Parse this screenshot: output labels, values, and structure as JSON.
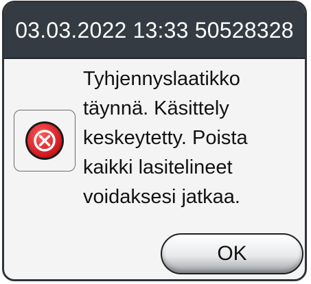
{
  "dialog": {
    "header": {
      "datetime": "03.03.2022 13:33",
      "serial": "50528328"
    },
    "icon": "error-icon",
    "message": "Tyhjennyslaatikko\ntäynnä. Käsittely\nkeskeytetty. Poista\nkaikki lasitelineet\nvoidaksesi jatkaa.",
    "ok_label": "OK"
  },
  "colors": {
    "titlebar": "#353b42",
    "error_red": "#e0242c"
  }
}
